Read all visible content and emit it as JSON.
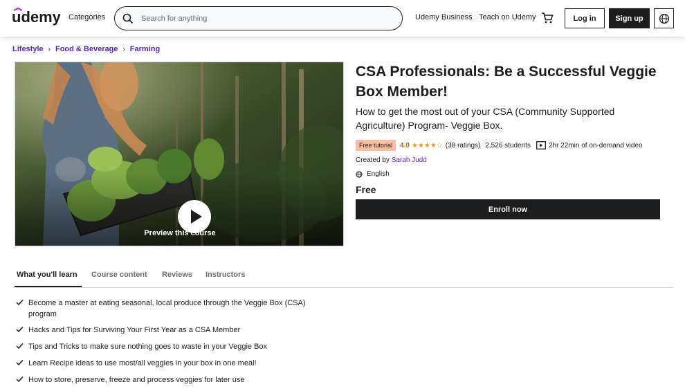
{
  "header": {
    "logo": "udemy",
    "categories_label": "Categories",
    "search_placeholder": "Search for anything",
    "business_label": "Udemy Business",
    "teach_label": "Teach on Udemy",
    "login_label": "Log in",
    "signup_label": "Sign up"
  },
  "breadcrumb": [
    "Lifestyle",
    "Food & Beverage",
    "Farming"
  ],
  "preview": {
    "label": "Preview this course"
  },
  "course": {
    "title": "CSA Professionals: Be a Successful Veggie Box Member!",
    "subtitle": "How to get the most out of your CSA (Community Supported Agriculture) Program- Veggie Box.",
    "badge": "Free tutorial",
    "rating": "4.0",
    "stars": "★★★★☆",
    "ratings_count": "(38 ratings)",
    "students": "2,526 students",
    "duration": "2hr 22min of on-demand video",
    "created_prefix": "Created by",
    "author": "Sarah Judd",
    "language": "English",
    "price": "Free",
    "enroll_label": "Enroll now"
  },
  "tabs": [
    "What you'll learn",
    "Course content",
    "Reviews",
    "Instructors"
  ],
  "learn": [
    "Become a master at eating seasonal, local produce through the Veggie Box (CSA) program",
    "Hacks and Tips for Surviving Your First Year as a CSA Member",
    "Tips and Tricks to make sure nothing goes to waste in your Veggie Box",
    "Learn Recipe ideas to use most/all veggies in your box in one meal!",
    "How to store, preserve, freeze and process veggies for later use"
  ],
  "colors": {
    "accent": "#5624d0",
    "dark": "#1c1d1f",
    "rating": "#b4690e",
    "star": "#e59819",
    "badge": "#fcbca0"
  }
}
